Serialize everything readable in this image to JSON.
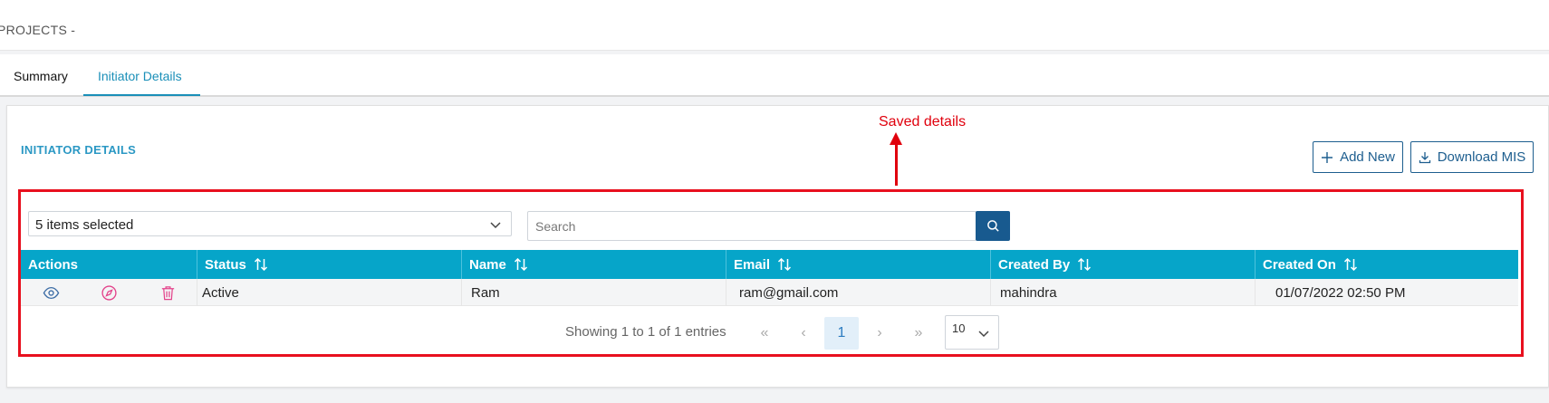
{
  "header": {
    "title": "PROJECTS -"
  },
  "tabs": [
    {
      "label": "Summary"
    },
    {
      "label": "Initiator Details"
    }
  ],
  "section": {
    "title": "INITIATOR DETAILS"
  },
  "annotation": {
    "text": "Saved details",
    "color": "#e0000d"
  },
  "toolbar": {
    "add_label": "Add New",
    "download_label": "Download MIS"
  },
  "filter": {
    "selected_text": "5 items selected"
  },
  "search": {
    "placeholder": "Search",
    "value": ""
  },
  "table": {
    "headers": [
      "Actions",
      "Status",
      "Name",
      "Email",
      "Created By",
      "Created On"
    ],
    "rows": [
      {
        "status": "Active",
        "name": "Ram",
        "email": "ram@gmail.com",
        "created_by": "mahindra",
        "created_on": "01/07/2022 02:50 PM"
      }
    ]
  },
  "pagination": {
    "showing_text": "Showing 1 to 1 of 1 entries",
    "first": "«",
    "prev": "‹",
    "current_page": "1",
    "next": "›",
    "last": "»",
    "page_size": "10"
  },
  "colors": {
    "accent": "#2b98c4",
    "table_header": "#06a5c9",
    "primary_button": "#185a8f",
    "annotation_frame": "#e8101e"
  },
  "icons": {
    "row_actions": [
      "eye-icon",
      "compass-icon",
      "trash-icon"
    ],
    "add": "plus-icon",
    "download": "download-icon",
    "search": "search-icon",
    "sort": "sort-icon"
  }
}
